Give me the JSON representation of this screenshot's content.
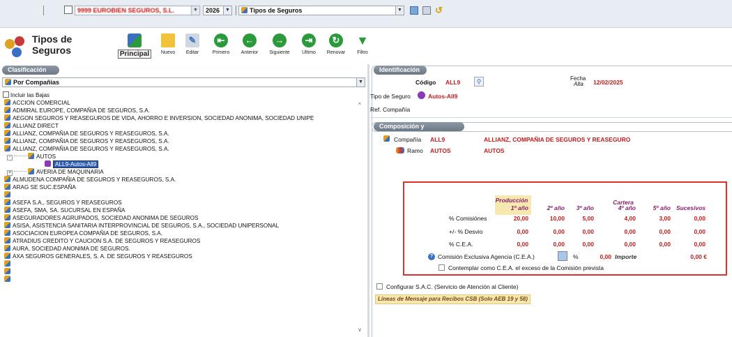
{
  "top": {
    "company_combo": "9999 EUROBIEN SEGUROS, S.L.",
    "year": "2026",
    "module_combo": "Tipos de Seguros"
  },
  "toolbar": {
    "title_line1": "Tipos de",
    "title_line2": "Seguros",
    "buttons": [
      {
        "label": "Principal",
        "icon": "principal-icon"
      },
      {
        "label": "Nuevo",
        "icon": "new-folder-icon"
      },
      {
        "label": "Editar",
        "icon": "edit-icon"
      },
      {
        "label": "Primero",
        "icon": "first-icon"
      },
      {
        "label": "Anterior",
        "icon": "previous-icon"
      },
      {
        "label": "Siguiente",
        "icon": "next-icon"
      },
      {
        "label": "Ultimo",
        "icon": "last-icon"
      },
      {
        "label": "Renovar",
        "icon": "renew-icon"
      },
      {
        "label": "Filtro",
        "icon": "filter-icon"
      }
    ]
  },
  "left": {
    "header": "Clasificación",
    "select_value": "Por Compañias",
    "include_bajas": "Incluir las Bajas",
    "tree": [
      {
        "label": "ACCION COMERCIAL",
        "indent": 0
      },
      {
        "label": "ADMIRAL EUROPE, COMPAÑIA DE SEGUROS, S.A.",
        "indent": 0
      },
      {
        "label": "AEGON SEGUROS Y REASEGUROS DE VIDA, AHORRO E INVERSION, SOCIEDAD ANONIMA, SOCIEDAD UNIPE",
        "indent": 0
      },
      {
        "label": "ALLIANZ DIRECT",
        "indent": 0
      },
      {
        "label": "ALLIANZ, COMPAÑIA DE SEGUROS Y REASEGUROS, S.A.",
        "indent": 0
      },
      {
        "label": "ALLIANZ, COMPAÑIA DE SEGUROS Y REASEGUROS, S.A.",
        "indent": 0
      },
      {
        "label": "ALLIANZ, COMPAÑIA DE SEGUROS Y REASEGUROS, S.A.",
        "indent": 0
      },
      {
        "label": "AUTOS",
        "indent": 1
      },
      {
        "label": "ALL9-Autos-All9",
        "indent": 2
      },
      {
        "label": "AVERIA DE MAQUINARIA",
        "indent": 1
      },
      {
        "label": "ALMUDENA COMPAÑIA DE SEGUROS Y REASEGUROS, S.A.",
        "indent": 0
      },
      {
        "label": "ARAG SE SUC.ESPAÑA",
        "indent": 0
      },
      {
        "label": "",
        "indent": 0
      },
      {
        "label": "ASEFA S.A., SEGUROS Y REASEGUROS",
        "indent": 0
      },
      {
        "label": "ASEFA, SMA, SA. SUCURSAL EN ESPAÑA",
        "indent": 0
      },
      {
        "label": "ASEGURADORES AGRUPADOS, SOCIEDAD ANONIMA DE SEGUROS",
        "indent": 0
      },
      {
        "label": "ASISA, ASISTENCIA SANITARIA INTERPROVINCIAL DE SEGUROS, S.A., SOCIEDAD UNIPERSONAL",
        "indent": 0
      },
      {
        "label": "ASOCIACION EUROPEA COMPAÑIA DE SEGUROS, S.A.",
        "indent": 0
      },
      {
        "label": "ATRADIUS CREDITO Y CAUCION S.A. DE SEGUROS Y REASEGUROS",
        "indent": 0
      },
      {
        "label": "AURA, SOCIEDAD ANONIMA DE SEGUROS.",
        "indent": 0
      },
      {
        "label": "AXA SEGUROS GENERALES, S. A. DE SEGUROS Y REASEGUROS",
        "indent": 0
      },
      {
        "label": "",
        "indent": 0
      },
      {
        "label": "",
        "indent": 0
      },
      {
        "label": "",
        "indent": 0
      }
    ]
  },
  "ident": {
    "header": "Identificación",
    "codigo_label": "Código",
    "codigo_value": "ALL9",
    "fecha_label": "Fecha",
    "alta_label": "Alta",
    "fecha_value": "12/02/2025",
    "tipo_label": "Tipo de Seguro",
    "tipo_value": "Autos-All9",
    "ref_label": "Ref. Compañía"
  },
  "comp": {
    "header": "Composición y Comisiones",
    "compania_label": "Compañía",
    "compania_code": "ALL9",
    "compania_name": "ALLIANZ, COMPAÑIA DE SEGUROS Y REASEGURO",
    "ramo_label": "Ramo",
    "ramo_code": "AUTOS",
    "ramo_name": "AUTOS"
  },
  "commissions": {
    "col_produccion": "Producción",
    "col_cartera": "Cartera",
    "cols": [
      "1º año",
      "2º año",
      "3º año",
      "4º año",
      "5º año",
      "Sucesivos"
    ],
    "rows": [
      {
        "label": "% Comisiónes",
        "values": [
          "20,00",
          "10,00",
          "5,00",
          "4,00",
          "3,00",
          "0,00"
        ]
      },
      {
        "label": "+/- % Desvio",
        "values": [
          "0,00",
          "0,00",
          "0,00",
          "0,00",
          "0,00",
          "0,00"
        ]
      },
      {
        "label": "% C.E.A.",
        "values": [
          "0,00",
          "0,00",
          "0,00",
          "0,00",
          "0,00",
          "0,00"
        ]
      }
    ],
    "cea_label": "Comisión Exclusiva Agencia (C.E.A.)",
    "cea_pct": "%",
    "cea_value": "0,00",
    "importe_label": "Importe",
    "importe_value": "0,00 €",
    "contemplar_label": "Contemplar como C.E.A. el exceso de la Comisión prevista"
  },
  "bottom": {
    "sac_label": "Configurar S.A.C. (Servicio de Atención al Cliente)",
    "lineas_label": "Líneas de Mensaje para Recibos CSB (Solo AEB 19 y 58)"
  },
  "colors": {
    "accent_red": "#c21a1a",
    "header_purple": "#8a1e6e",
    "highlight_border": "#e0302b"
  }
}
